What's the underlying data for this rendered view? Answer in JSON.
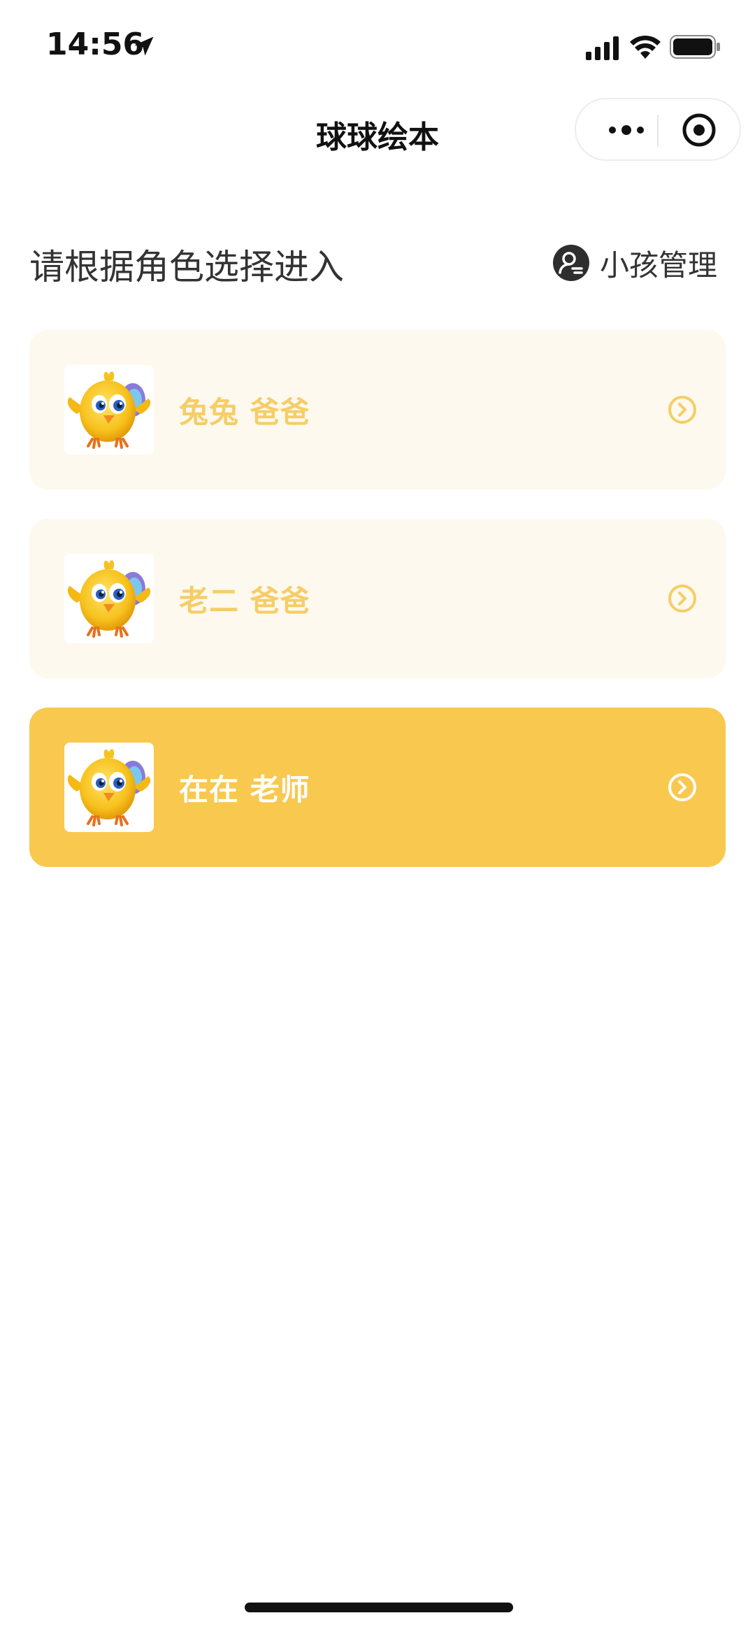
{
  "status_bar": {
    "time": "14:56",
    "icons": [
      "location-arrow-icon",
      "signal-icon",
      "wifi-icon",
      "battery-icon"
    ]
  },
  "nav": {
    "title": "球球绘本",
    "capsule_icons": [
      "more-dots-icon",
      "close-target-icon"
    ]
  },
  "header": {
    "prompt": "请根据角色选择进入",
    "manage_label": "小孩管理",
    "manage_icon": "person-settings-icon"
  },
  "roles": [
    {
      "name": "兔兔 爸爸",
      "state": "light",
      "avatar_icon": "yellow-chick-avatar",
      "arrow_icon": "chevron-circle-right-icon"
    },
    {
      "name": "老二 爸爸",
      "state": "light",
      "avatar_icon": "yellow-chick-avatar",
      "arrow_icon": "chevron-circle-right-icon"
    },
    {
      "name": "在在 老师",
      "state": "active",
      "avatar_icon": "yellow-chick-avatar",
      "arrow_icon": "chevron-circle-right-icon"
    }
  ],
  "colors": {
    "accent": "#f8c84f",
    "card_light_bg": "#fdf9ee",
    "card_light_text": "#f6cd66",
    "card_active_text": "#ffffff"
  }
}
